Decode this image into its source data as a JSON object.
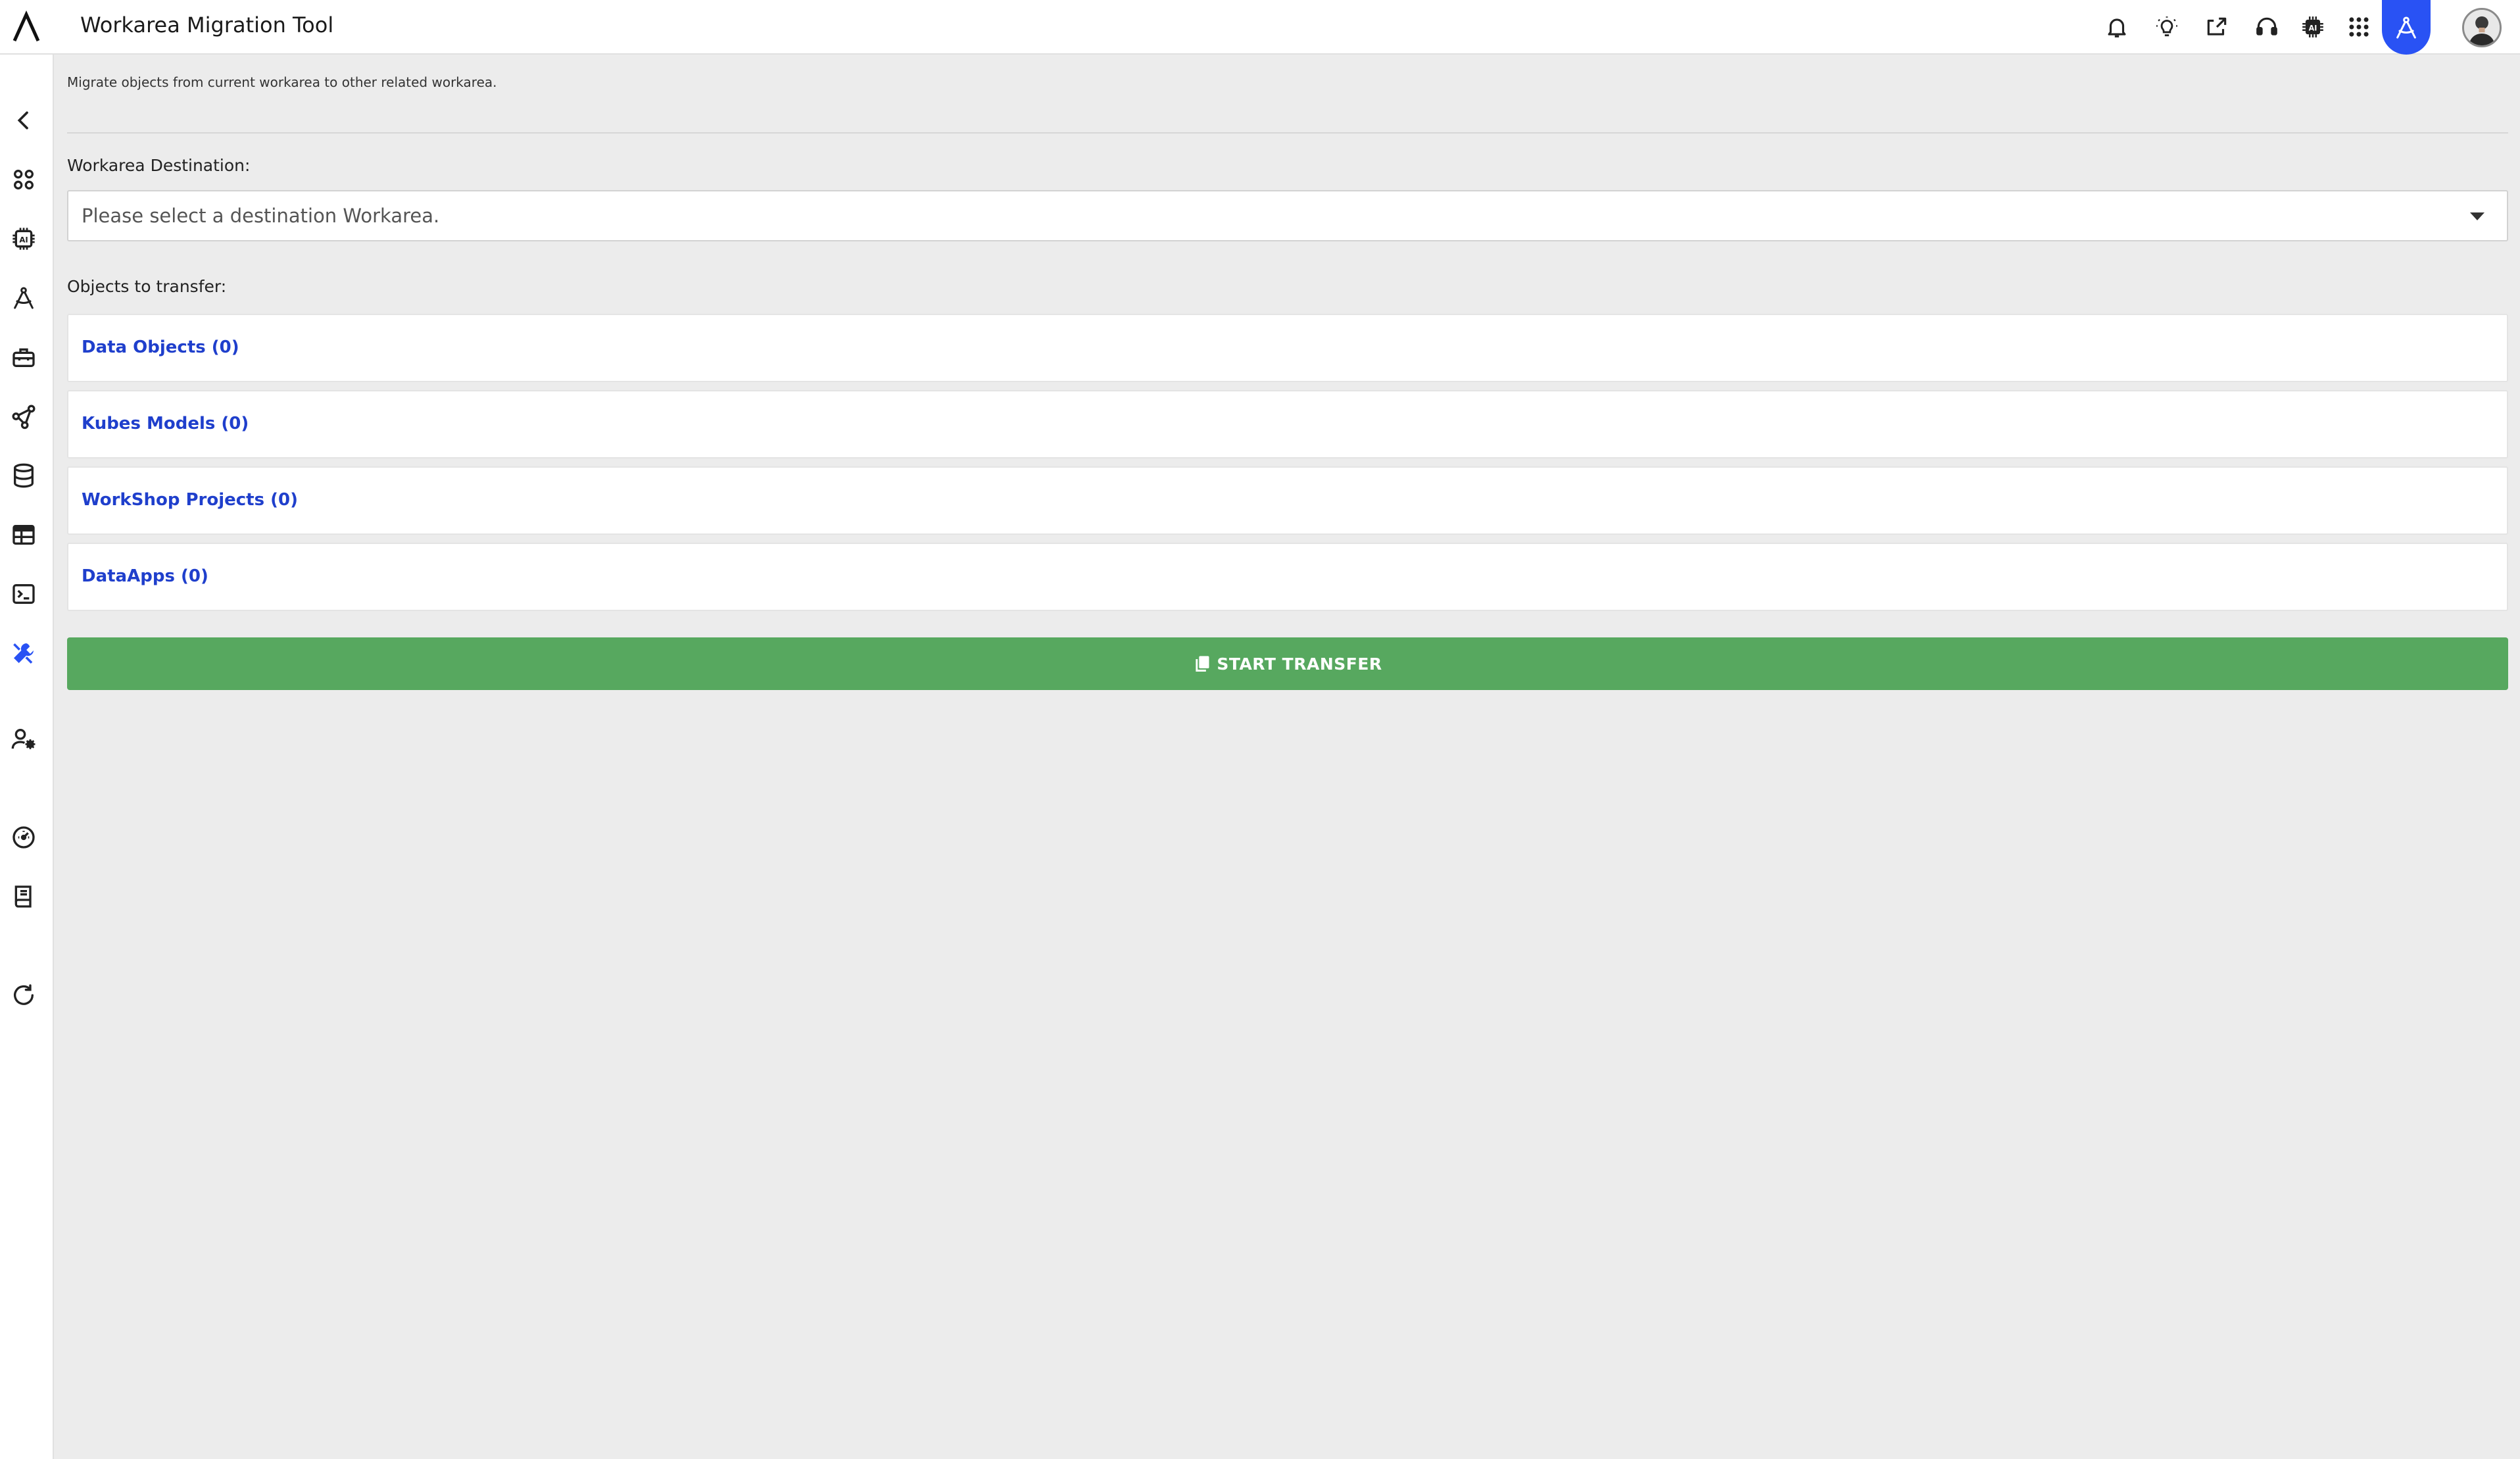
{
  "app": {
    "title": "Workarea Migration Tool"
  },
  "header_icons": [
    "bell-icon",
    "lightbulb-icon",
    "share-icon",
    "support-headset-icon",
    "ai-chip-icon",
    "apps-grid-icon",
    "compass-icon",
    "avatar"
  ],
  "sidebar": {
    "icons": [
      "back-chevron-icon",
      "dashboard-icon",
      "ai-chip-icon",
      "compass-icon",
      "toolbox-icon",
      "network-icon",
      "database-icon",
      "table-icon",
      "terminal-icon",
      "tools-icon",
      "user-settings-icon",
      "speedometer-icon",
      "book-icon",
      "refresh-icon"
    ],
    "active": "tools-icon"
  },
  "main": {
    "description": "Migrate objects from current workarea to other related workarea.",
    "destination_label": "Workarea Destination:",
    "destination_placeholder": "Please select a destination Workarea.",
    "objects_label": "Objects to transfer:",
    "panels": [
      {
        "label": "Data Objects (0)"
      },
      {
        "label": "Kubes Models (0)"
      },
      {
        "label": "WorkShop Projects (0)"
      },
      {
        "label": "DataApps (0)"
      }
    ],
    "start_button": "START TRANSFER"
  },
  "colors": {
    "accent": "#2952f4",
    "link": "#1f3fcc",
    "success": "#57a85f",
    "background": "#ececec"
  }
}
